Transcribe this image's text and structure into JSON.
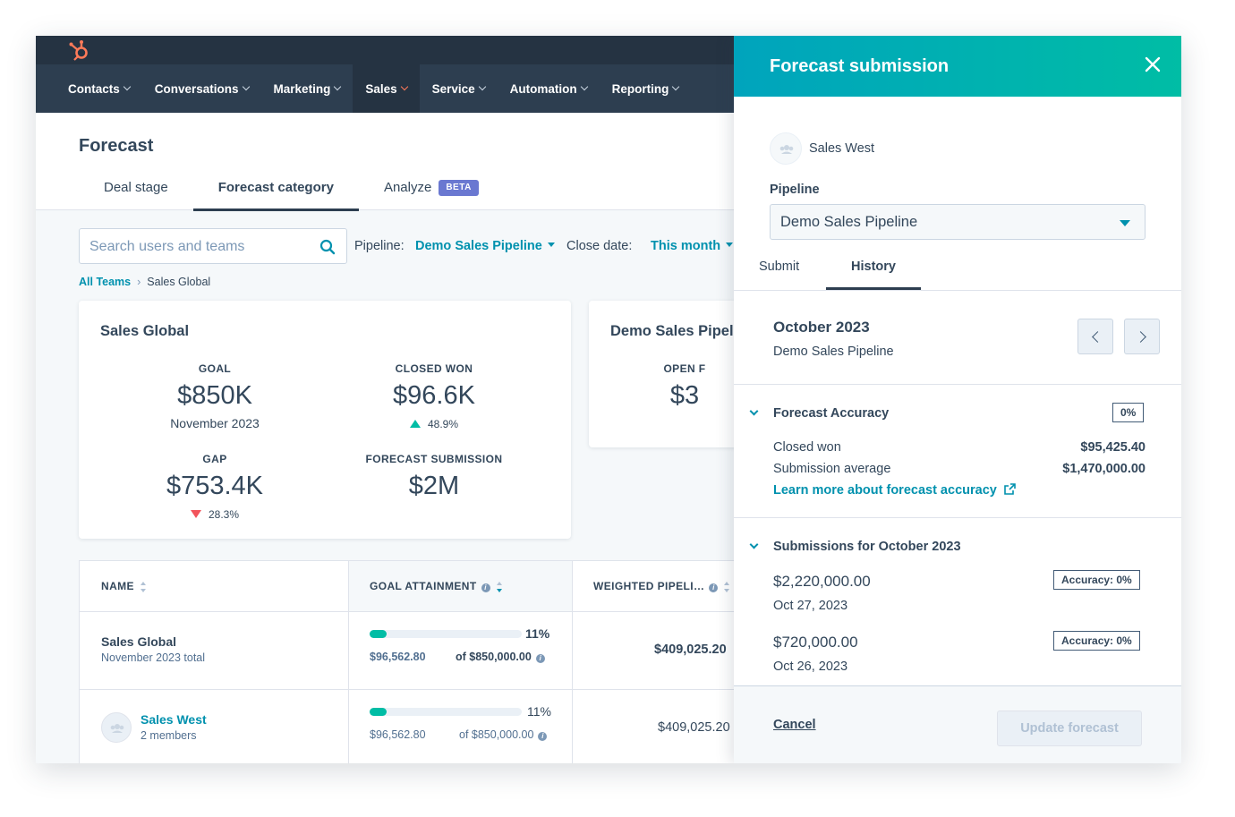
{
  "nav": {
    "items": [
      "Contacts",
      "Conversations",
      "Marketing",
      "Sales",
      "Service",
      "Automation",
      "Reporting"
    ],
    "active": "Sales"
  },
  "page": {
    "title": "Forecast",
    "tabs": [
      "Deal stage",
      "Forecast category",
      "Analyze"
    ],
    "active_tab": "Forecast category",
    "beta_badge": "BETA"
  },
  "filters": {
    "search_placeholder": "Search users and teams",
    "pipeline_label": "Pipeline:",
    "pipeline_value": "Demo Sales Pipeline",
    "close_date_label": "Close date:",
    "close_date_value": "This month"
  },
  "breadcrumb": {
    "root": "All Teams",
    "current": "Sales Global"
  },
  "summary_card": {
    "title": "Sales Global",
    "goal": {
      "label": "GOAL",
      "value": "$850K",
      "sub": "November 2023"
    },
    "closed_won": {
      "label": "CLOSED WON",
      "value": "$96.6K",
      "change": "48.9%"
    },
    "gap": {
      "label": "GAP",
      "value": "$753.4K",
      "change": "28.3%"
    },
    "forecast_submission": {
      "label": "FORECAST SUBMISSION",
      "value": "$2M"
    }
  },
  "pipeline_card": {
    "title": "Demo Sales Pipel",
    "label": "OPEN F",
    "value": "$3"
  },
  "table": {
    "headers": [
      "NAME",
      "GOAL ATTAINMENT",
      "WEIGHTED PIPELI…"
    ],
    "rows": [
      {
        "name": "Sales Global",
        "sub": "November 2023 total",
        "progress": 11,
        "pct": "11%",
        "amount": "$96,562.80",
        "of": "of $850,000.00",
        "weighted": "$409,025.20"
      },
      {
        "name": "Sales West",
        "sub": "2 members",
        "progress": 11,
        "pct": "11%",
        "amount": "$96,562.80",
        "of": "of $850,000.00",
        "weighted": "$409,025.20"
      }
    ]
  },
  "panel": {
    "title": "Forecast submission",
    "team": "Sales West",
    "pipeline_label": "Pipeline",
    "pipeline_value": "Demo Sales Pipeline",
    "tabs": [
      "Submit",
      "History"
    ],
    "active_tab": "History",
    "period": "October 2023",
    "period_pipeline": "Demo Sales Pipeline",
    "accuracy": {
      "title": "Forecast Accuracy",
      "badge": "0%",
      "closed_won_label": "Closed won",
      "closed_won_value": "$95,425.40",
      "avg_label": "Submission average",
      "avg_value": "$1,470,000.00",
      "learn_more": "Learn more about forecast accuracy"
    },
    "submissions": {
      "title": "Submissions for October 2023",
      "items": [
        {
          "amount": "$2,220,000.00",
          "date": "Oct 27, 2023",
          "accuracy": "Accuracy: 0%"
        },
        {
          "amount": "$720,000.00",
          "date": "Oct 26, 2023",
          "accuracy": "Accuracy: 0%"
        }
      ]
    },
    "cancel": "Cancel",
    "update": "Update forecast"
  },
  "colors": {
    "accent": "#0091ae",
    "teal": "#00bda5",
    "nav_bg": "#2d3e50",
    "negative": "#f2545b",
    "brand": "#ff7a59"
  }
}
